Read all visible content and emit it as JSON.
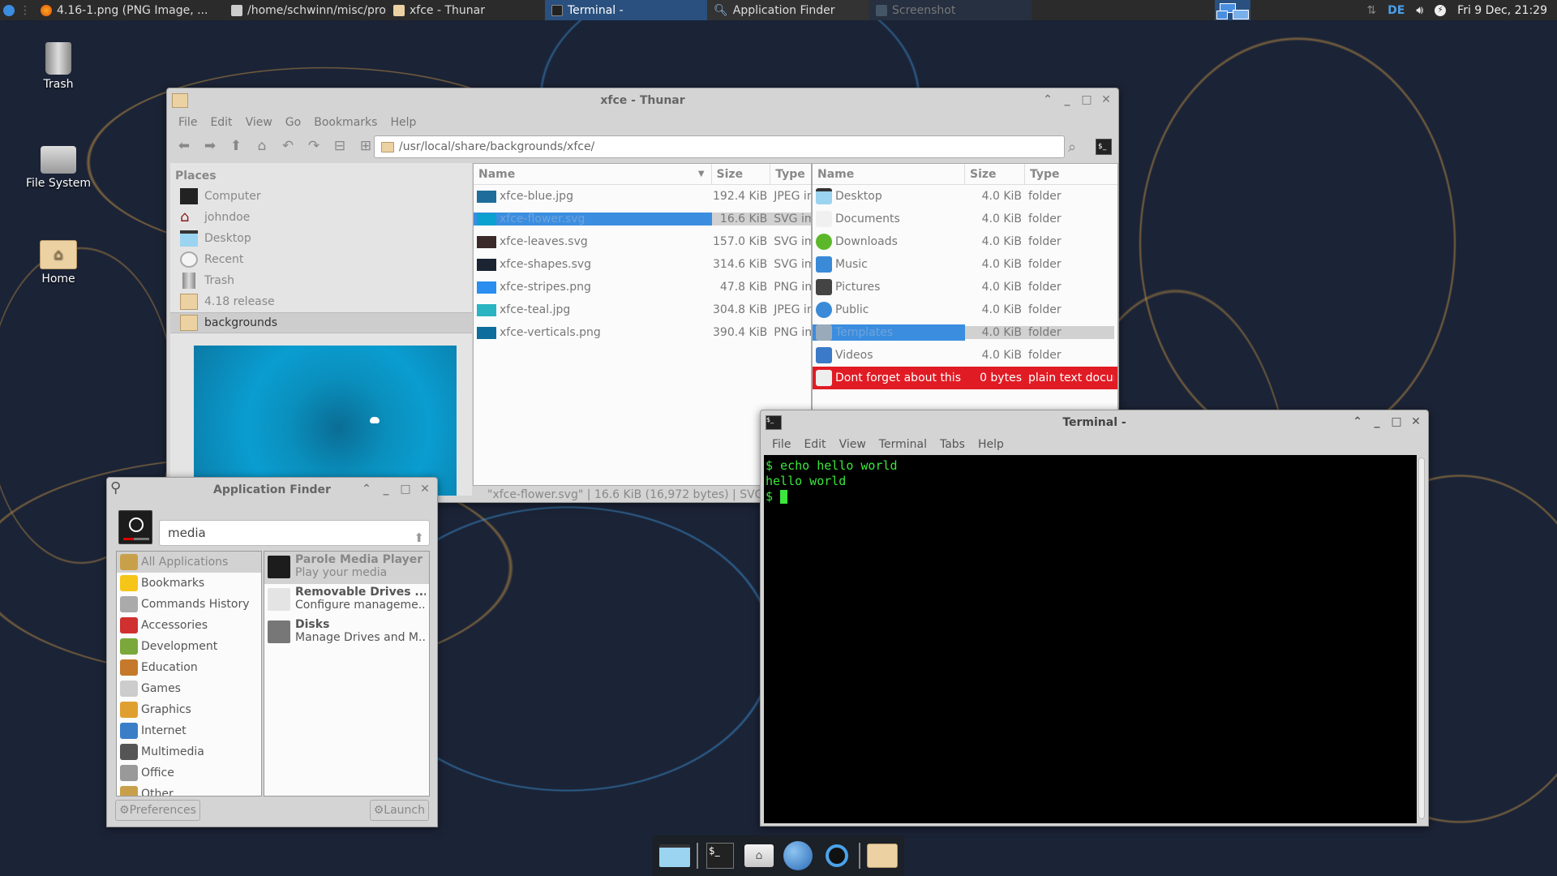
{
  "panel": {
    "tasks": [
      {
        "label": "4.16-1.png (PNG Image, ...",
        "icon": "firefox-icon"
      },
      {
        "label": "/home/schwinn/misc/pro...",
        "icon": "text-editor-icon"
      },
      {
        "label": "xfce - Thunar",
        "icon": "folder-icon"
      },
      {
        "label": "Terminal -",
        "icon": "terminal-icon",
        "active": true
      },
      {
        "label": "Application Finder",
        "icon": "search-icon"
      },
      {
        "label": "Screenshot",
        "icon": "screenshot-icon",
        "dim": true
      }
    ],
    "keyboard_layout": "DE",
    "clock": "Fri  9 Dec, 21:29"
  },
  "desktop": {
    "icons": [
      {
        "label": "Trash",
        "icon": "trash-icon"
      },
      {
        "label": "File System",
        "icon": "hard-drive-icon"
      },
      {
        "label": "Home",
        "icon": "home-folder-icon"
      }
    ]
  },
  "thunar": {
    "title": "xfce - Thunar",
    "menu": [
      "File",
      "Edit",
      "View",
      "Go",
      "Bookmarks",
      "Help"
    ],
    "location": "/usr/local/share/backgrounds/xfce/",
    "places_header": "Places",
    "places": [
      {
        "label": "Computer",
        "icon": "computer-icon"
      },
      {
        "label": "johndoe",
        "icon": "home-icon"
      },
      {
        "label": "Desktop",
        "icon": "desktop-icon"
      },
      {
        "label": "Recent",
        "icon": "recent-icon"
      },
      {
        "label": "Trash",
        "icon": "trash-icon"
      },
      {
        "label": "4.18 release",
        "icon": "folder-icon"
      },
      {
        "label": "backgrounds",
        "icon": "folder-icon",
        "selected": true
      }
    ],
    "left_pane": {
      "columns": [
        "Name",
        "Size",
        "Type"
      ],
      "rows": [
        {
          "name": "xfce-blue.jpg",
          "size": "192.4  KiB",
          "type": "JPEG image",
          "thumb": "#1f6d9b"
        },
        {
          "name": "xfce-flower.svg",
          "size": "16.6  KiB",
          "type": "SVG image",
          "thumb": "#0aa0cf",
          "selected": true
        },
        {
          "name": "xfce-leaves.svg",
          "size": "157.0  KiB",
          "type": "SVG image",
          "thumb": "#3a2a2a"
        },
        {
          "name": "xfce-shapes.svg",
          "size": "314.6  KiB",
          "type": "SVG image",
          "thumb": "#1a2433"
        },
        {
          "name": "xfce-stripes.png",
          "size": "47.8  KiB",
          "type": "PNG image",
          "thumb": "#2a8ef0"
        },
        {
          "name": "xfce-teal.jpg",
          "size": "304.8  KiB",
          "type": "JPEG image",
          "thumb": "#2ab3c0"
        },
        {
          "name": "xfce-verticals.png",
          "size": "390.4  KiB",
          "type": "PNG image",
          "thumb": "#0d6e9e"
        }
      ]
    },
    "right_pane": {
      "columns": [
        "Name",
        "Size",
        "Type"
      ],
      "rows": [
        {
          "name": "Desktop",
          "size": "4.0  KiB",
          "type": "folder",
          "icon": "desktop-icon"
        },
        {
          "name": "Documents",
          "size": "4.0  KiB",
          "type": "folder",
          "icon": "document-icon"
        },
        {
          "name": "Downloads",
          "size": "4.0  KiB",
          "type": "folder",
          "icon": "download-icon"
        },
        {
          "name": "Music",
          "size": "4.0  KiB",
          "type": "folder",
          "icon": "music-icon"
        },
        {
          "name": "Pictures",
          "size": "4.0  KiB",
          "type": "folder",
          "icon": "pictures-icon"
        },
        {
          "name": "Public",
          "size": "4.0  KiB",
          "type": "folder",
          "icon": "share-icon"
        },
        {
          "name": "Templates",
          "size": "4.0  KiB",
          "type": "folder",
          "icon": "templates-icon",
          "selected": true
        },
        {
          "name": "Videos",
          "size": "4.0  KiB",
          "type": "folder",
          "icon": "video-icon"
        },
        {
          "name": "Dont forget about this !",
          "size": "0 bytes",
          "type": "plain text document",
          "icon": "text-file-icon",
          "highlight": true
        }
      ]
    },
    "status": "\"xfce-flower.svg\"  |  16.6  KiB (16,972 bytes)  |  SVG image"
  },
  "appfinder": {
    "title": "Application Finder",
    "search_value": "media",
    "categories": [
      {
        "label": "All Applications",
        "selected": true,
        "color": "#c9a04a"
      },
      {
        "label": "Bookmarks",
        "color": "#f5c518"
      },
      {
        "label": "Commands History",
        "color": "#aaaaaa"
      },
      {
        "label": "Accessories",
        "color": "#d03030"
      },
      {
        "label": "Development",
        "color": "#7aa83a"
      },
      {
        "label": "Education",
        "color": "#c47a2a"
      },
      {
        "label": "Games",
        "color": "#cccccc"
      },
      {
        "label": "Graphics",
        "color": "#e0a030"
      },
      {
        "label": "Internet",
        "color": "#3a7ec8"
      },
      {
        "label": "Multimedia",
        "color": "#555555"
      },
      {
        "label": "Office",
        "color": "#999999"
      },
      {
        "label": "Other",
        "color": "#c9a04a"
      }
    ],
    "apps": [
      {
        "name": "Parole Media Player",
        "desc": "Play your media",
        "selected": true,
        "color": "#1c1c1c"
      },
      {
        "name": "Removable Drives ...",
        "desc": "Configure manageme...",
        "color": "#e4e4e4"
      },
      {
        "name": "Disks",
        "desc": "Manage Drives and M...",
        "color": "#777777"
      }
    ],
    "preferences_label": "Preferences",
    "launch_label": "Launch"
  },
  "terminal": {
    "title": "Terminal -",
    "menu": [
      "File",
      "Edit",
      "View",
      "Terminal",
      "Tabs",
      "Help"
    ],
    "lines": [
      "$ echo hello world",
      "hello world"
    ],
    "prompt": "$ "
  },
  "dock": {
    "items": [
      {
        "name": "show-desktop",
        "icon": "desktop-icon"
      },
      {
        "name": "terminal",
        "icon": "terminal-icon"
      },
      {
        "name": "home-folder",
        "icon": "home-folder-icon"
      },
      {
        "name": "web-browser",
        "icon": "globe-icon"
      },
      {
        "name": "app-finder",
        "icon": "search-icon"
      },
      {
        "name": "file-manager",
        "icon": "folder-icon"
      }
    ]
  }
}
